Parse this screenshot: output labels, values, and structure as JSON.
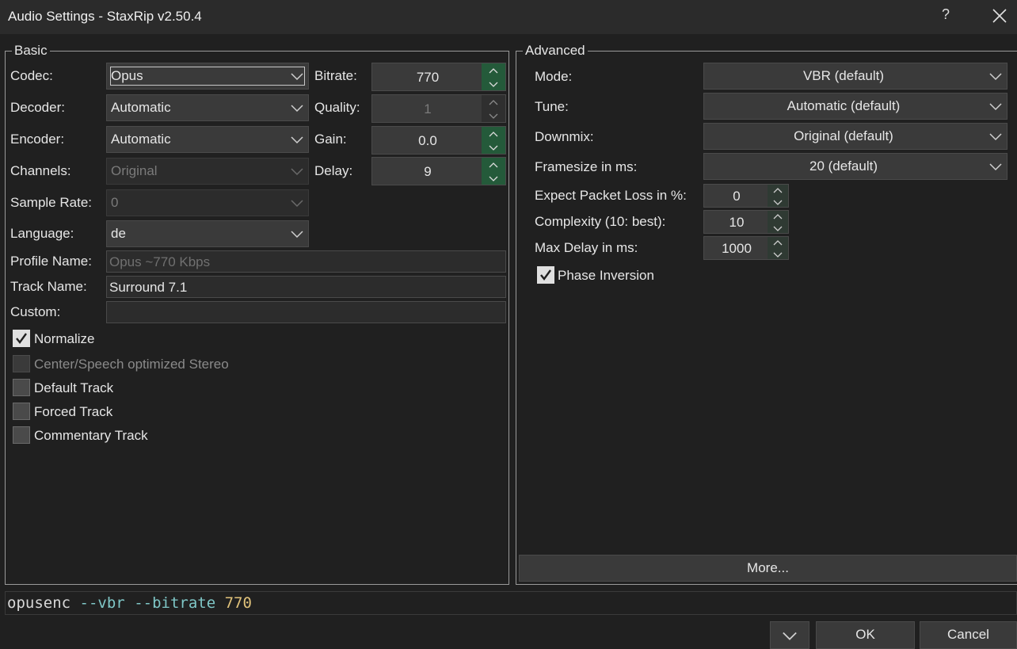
{
  "window": {
    "title": "Audio Settings - StaxRip v2.50.4",
    "help_label": "?"
  },
  "basic": {
    "group_label": "Basic",
    "codec_label": "Codec:",
    "codec_value": "Opus",
    "decoder_label": "Decoder:",
    "decoder_value": "Automatic",
    "encoder_label": "Encoder:",
    "encoder_value": "Automatic",
    "channels_label": "Channels:",
    "channels_value": "Original",
    "samplerate_label": "Sample Rate:",
    "samplerate_value": "0",
    "language_label": "Language:",
    "language_value": "de",
    "bitrate_label": "Bitrate:",
    "bitrate_value": "770",
    "quality_label": "Quality:",
    "quality_value": "1",
    "gain_label": "Gain:",
    "gain_value": "0.0",
    "delay_label": "Delay:",
    "delay_value": "9",
    "profile_name_label": "Profile Name:",
    "profile_name_placeholder": "Opus ~770 Kbps",
    "track_name_label": "Track Name:",
    "track_name_value": "Surround 7.1",
    "custom_label": "Custom:",
    "custom_value": "",
    "checkboxes": [
      {
        "label": "Normalize",
        "checked": true,
        "enabled": true
      },
      {
        "label": "Center/Speech optimized Stereo",
        "checked": false,
        "enabled": false
      },
      {
        "label": "Default Track",
        "checked": false,
        "enabled": true
      },
      {
        "label": "Forced Track",
        "checked": false,
        "enabled": true
      },
      {
        "label": "Commentary Track",
        "checked": false,
        "enabled": true
      }
    ]
  },
  "advanced": {
    "group_label": "Advanced",
    "mode_label": "Mode:",
    "mode_value": "VBR (default)",
    "tune_label": "Tune:",
    "tune_value": "Automatic (default)",
    "downmix_label": "Downmix:",
    "downmix_value": "Original (default)",
    "framesize_label": "Framesize in ms:",
    "framesize_value": "20 (default)",
    "packetloss_label": "Expect Packet Loss in %:",
    "packetloss_value": "0",
    "complexity_label": "Complexity (10: best):",
    "complexity_value": "10",
    "maxdelay_label": "Max Delay in ms:",
    "maxdelay_value": "1000",
    "phase_inversion_label": "Phase Inversion",
    "phase_inversion_checked": true,
    "more_label": "More..."
  },
  "command_line": {
    "exe": "opusenc",
    "flag1": "--vbr",
    "flag2": "--bitrate",
    "value": "770"
  },
  "footer": {
    "ok_label": "OK",
    "cancel_label": "Cancel"
  },
  "colors": {
    "background": "#202020",
    "control": "#3a3a3a",
    "spin_accent": "#245a3a",
    "flag": "#7fc7c7",
    "number": "#e0c27a"
  }
}
